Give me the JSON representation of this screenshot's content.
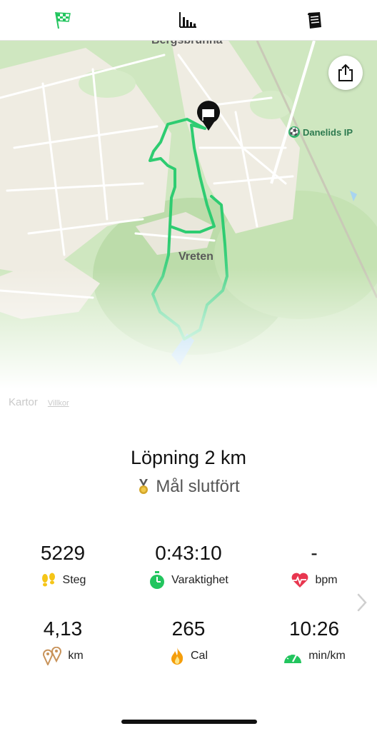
{
  "tabs": [
    {
      "name": "route-flag-icon",
      "active": true
    },
    {
      "name": "chart-icon",
      "active": false
    },
    {
      "name": "notes-icon",
      "active": false
    }
  ],
  "map": {
    "labels": {
      "top": "Bergsbrunna",
      "district": "Vreten",
      "poi": "Danelids IP",
      "attribution": "Kartor",
      "terms": "Villkor"
    }
  },
  "workout": {
    "title": "Löpning 2 km",
    "goal": "Mål slutfört"
  },
  "stats": [
    {
      "value": "5229",
      "label": "Steg",
      "icon": "footsteps-icon"
    },
    {
      "value": "0:43:10",
      "label": "Varaktighet",
      "icon": "stopwatch-icon"
    },
    {
      "value": "-",
      "label": "bpm",
      "icon": "heart-rate-icon"
    },
    {
      "value": "4,13",
      "label": "km",
      "icon": "location-pins-icon"
    },
    {
      "value": "265",
      "label": "Cal",
      "icon": "flame-icon"
    },
    {
      "value": "10:26",
      "label": "min/km",
      "icon": "speedometer-icon"
    }
  ],
  "colors": {
    "accent": "#22c55e",
    "route": "#2ecc71",
    "heart": "#e8364f",
    "flame": "#f59e0b",
    "pins": "#c8935a",
    "feet": "#f5c518"
  }
}
